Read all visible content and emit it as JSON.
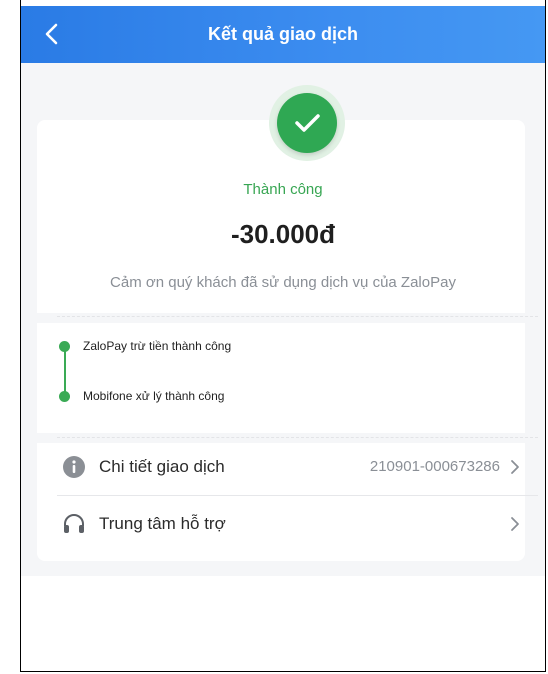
{
  "header": {
    "title": "Kết quả giao dịch",
    "back_icon": "chevron-left-icon"
  },
  "result": {
    "status": "Thành công",
    "amount": "-30.000đ",
    "message": "Cảm ơn quý khách đã sử dụng dịch vụ của ZaloPay",
    "icon": "check-icon"
  },
  "steps": [
    {
      "label": "ZaloPay trừ tiền thành công"
    },
    {
      "label": "Mobifone xử lý thành công"
    }
  ],
  "rows": {
    "details": {
      "label": "Chi tiết giao dịch",
      "value": "210901-000673286",
      "icon": "info-icon"
    },
    "support": {
      "label": "Trung tâm hỗ trợ",
      "icon": "headset-icon"
    }
  },
  "colors": {
    "header": "#3388ee",
    "success": "#2fa853",
    "background": "#f5f6f8"
  }
}
